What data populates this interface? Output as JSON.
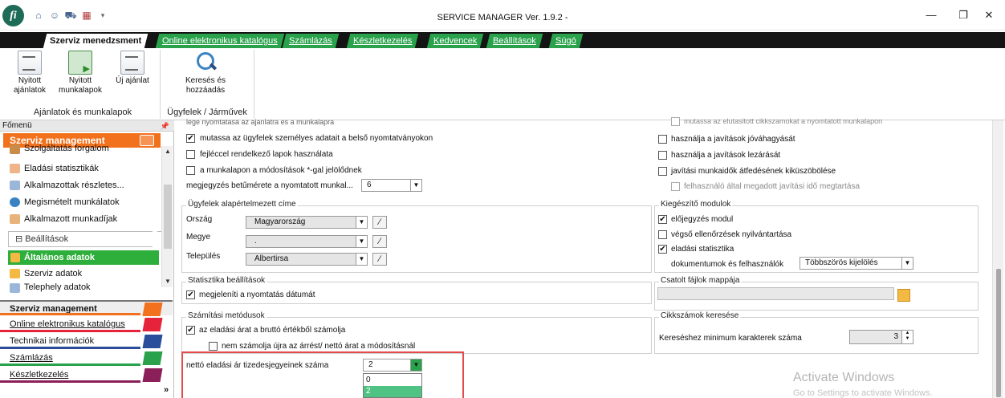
{
  "window": {
    "title": "SERVICE MANAGER Ver. 1.9.2 -",
    "logo_letter": "fi",
    "controls": {
      "minimize": "—",
      "maximize": "❐",
      "close": "✕"
    }
  },
  "ribbon": {
    "tabs": [
      "Szerviz menedzsment",
      "Online elektronikus katalógus",
      "Számlázás",
      "Készletkezelés",
      "Kedvencek",
      "Beállítások",
      "Súgó"
    ],
    "groups": [
      {
        "label": "Ajánlatok és munkalapok",
        "buttons": [
          "Nyitott ajánlatok",
          "Nyitott munkalapok",
          "Új ajánlat"
        ]
      },
      {
        "label": "Ügyfelek / Járművek",
        "buttons": [
          "Keresés és hozzáadás"
        ]
      }
    ]
  },
  "nav": {
    "header": "Főmenü",
    "pin": "📌",
    "band_top": "Szerviz management",
    "items": [
      "Szolgáltatás forgalom",
      "Eladási statisztikák",
      "Alkalmazottak részletes...",
      "Megismételt munkálatok",
      "Alkalmazott munkadíjak"
    ],
    "settings": "Beállítások",
    "active_item": "Általános adatok",
    "subitems": [
      "Szerviz adatok",
      "Telephely adatok"
    ],
    "bottom": [
      {
        "label": "Szerviz management",
        "color": "#f2711c"
      },
      {
        "label": "Online elektronikus katalógus",
        "color": "#e5243b"
      },
      {
        "label": "Technikai információk",
        "color": "#2b4e9c"
      },
      {
        "label": "Számlázás",
        "color": "#2aa24c"
      },
      {
        "label": "Készletkezelés",
        "color": "#8a1f5a"
      }
    ],
    "expand": "»"
  },
  "content": {
    "top_cut": "lege nyomtatasa az ajanlatra es a munkalapra",
    "left_checks": [
      {
        "label": "mutassa az ügyfelek személyes adatait a belső nyomtatványokon",
        "checked": true
      },
      {
        "label": "fejléccel rendelkező lapok használata",
        "checked": false
      },
      {
        "label": "a munkalapon a módosítások *-gal jelölődnek",
        "checked": false
      }
    ],
    "font_size_label": "megjegyzés betűmérete a nyomtatott munkal...",
    "font_size_value": "6",
    "right_top_cut": "mutassa az elutasitott cikkszamokat a nyomtatott munkalapon",
    "right_checks": [
      {
        "label": "használja a javítások jóváhagyását",
        "checked": false
      },
      {
        "label": "használja a javítások lezárását",
        "checked": false
      },
      {
        "label": "javítási munkaidők átfedésének kiküszöbölése",
        "checked": false
      }
    ],
    "right_sub_check": "felhasználó által megadott javítási idő megtartása",
    "address": {
      "title": "Ügyfelek alapértelmezett címe",
      "country_label": "Ország",
      "country_value": "Magyarország",
      "county_label": "Megye",
      "county_value": ".",
      "city_label": "Település",
      "city_value": "Albertirsa"
    },
    "modules": {
      "title": "Kiegészítő modulok",
      "checks": [
        {
          "label": "előjegyzés modul",
          "checked": true
        },
        {
          "label": "végső ellenőrzések nyilvántartása",
          "checked": false
        },
        {
          "label": "eladási statisztika",
          "checked": true
        }
      ],
      "docs_label": "dokumentumok és felhasználók",
      "docs_value": "Többszörös kijelölés"
    },
    "stats": {
      "title": "Statisztika beállítások",
      "check": "megjeleníti a nyomtatás dátumát"
    },
    "attach": {
      "title": "Csatolt fájlok mappája"
    },
    "calc": {
      "title": "Számítási metódusok",
      "check1": "az eladási árat a bruttó értékből számolja",
      "check2": "nem számolja újra az árrést/ nettó árat a módosításnál",
      "decimals_label": "nettó eladási ár tizedesjegyeinek száma",
      "decimals_value": "2",
      "options": [
        "0",
        "2"
      ]
    },
    "partsearch": {
      "title": "Cikkszámok keresése",
      "label": "Kereséshez minimum karakterek száma",
      "value": "3"
    },
    "watermark": {
      "line1": "Activate Windows",
      "line2": "Go to Settings to activate Windows."
    }
  }
}
